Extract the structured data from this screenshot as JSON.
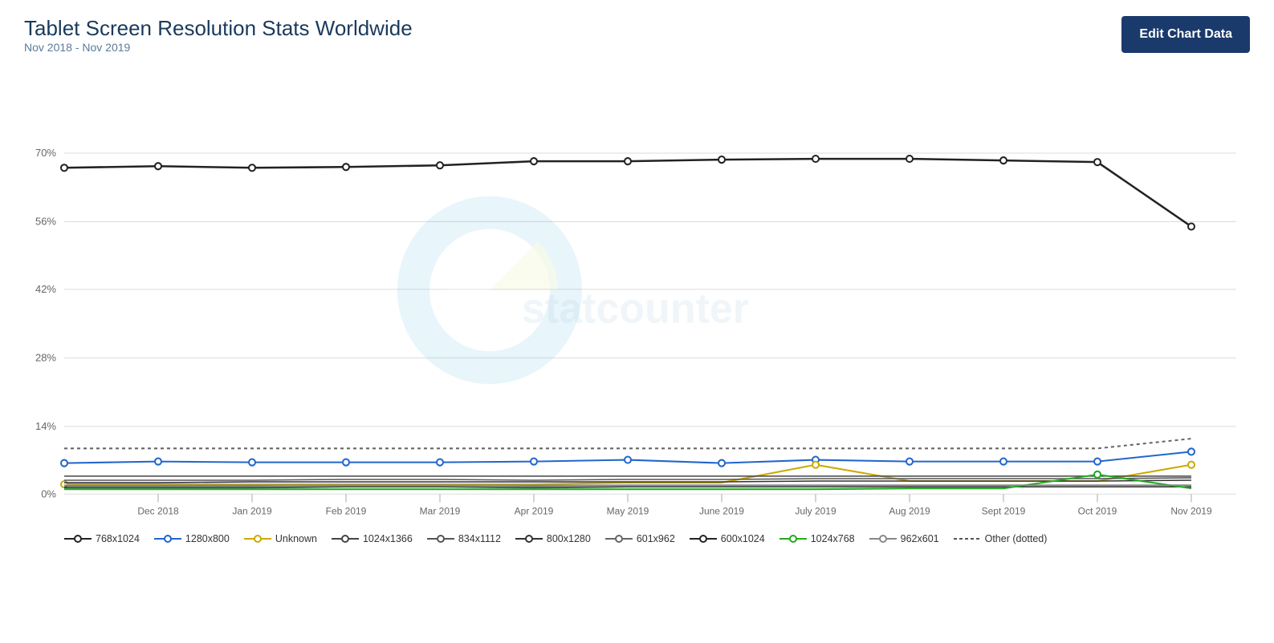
{
  "header": {
    "title": "Tablet Screen Resolution Stats Worldwide",
    "subtitle": "Nov 2018 - Nov 2019",
    "edit_button": "Edit Chart Data"
  },
  "chart": {
    "y_labels": [
      "0%",
      "14%",
      "28%",
      "42%",
      "56%",
      "70%"
    ],
    "x_labels": [
      "Dec 2018",
      "Jan 2019",
      "Feb 2019",
      "Mar 2019",
      "Apr 2019",
      "May 2019",
      "June 2019",
      "July 2019",
      "Aug 2019",
      "Sept 2019",
      "Oct 2019",
      "Nov 2019"
    ],
    "watermark": "statcounter"
  },
  "legend": {
    "items": [
      {
        "label": "768x1024",
        "color": "#333",
        "style": "solid",
        "dot": true
      },
      {
        "label": "1280x800",
        "color": "#2266cc",
        "style": "solid",
        "dot": true
      },
      {
        "label": "Unknown",
        "color": "#ccaa00",
        "style": "solid",
        "dot": true
      },
      {
        "label": "1024x1366",
        "color": "#555",
        "style": "solid",
        "dot": true
      },
      {
        "label": "834x1112",
        "color": "#444",
        "style": "solid",
        "dot": true
      },
      {
        "label": "800x1280",
        "color": "#333",
        "style": "solid",
        "dot": true
      },
      {
        "label": "601x962",
        "color": "#444",
        "style": "solid",
        "dot": true
      },
      {
        "label": "600x1024",
        "color": "#222",
        "style": "solid",
        "dot": true
      },
      {
        "label": "1024x768",
        "color": "#22aa22",
        "style": "solid",
        "dot": true
      },
      {
        "label": "962x601",
        "color": "#555",
        "style": "solid",
        "dot": true
      },
      {
        "label": "Other (dotted)",
        "color": "#555",
        "style": "dotted",
        "dot": false
      }
    ]
  }
}
